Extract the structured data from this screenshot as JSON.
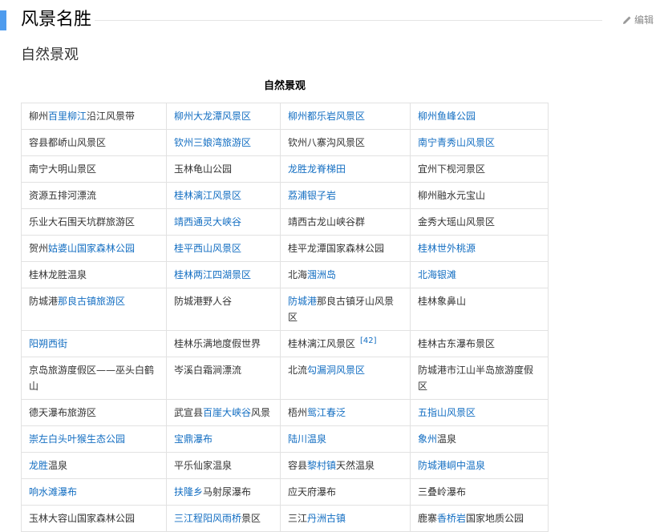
{
  "title": "风景名胜",
  "edit_label": "编辑",
  "subheading": "自然景观",
  "table_caption": "自然景观",
  "accent_color": "#4f9cee",
  "link_color": "#136ec2",
  "edit_icon": "pencil-icon",
  "rows": [
    [
      [
        {
          "t": "柳州"
        },
        {
          "t": "百里柳江",
          "l": true
        },
        {
          "t": "沿江风景带"
        }
      ],
      [
        {
          "t": "柳州大龙潭风景区",
          "l": true
        }
      ],
      [
        {
          "t": "柳州都乐岩风景区",
          "l": true
        }
      ],
      [
        {
          "t": "柳州鱼峰公园",
          "l": true
        }
      ]
    ],
    [
      [
        {
          "t": "容县都峤山风景区"
        }
      ],
      [
        {
          "t": "钦州三娘湾旅游区",
          "l": true
        }
      ],
      [
        {
          "t": "钦州八寨沟风景区"
        }
      ],
      [
        {
          "t": "南宁青秀山风景区",
          "l": true
        }
      ]
    ],
    [
      [
        {
          "t": "南宁大明山景区"
        }
      ],
      [
        {
          "t": "玉林龟山公园"
        }
      ],
      [
        {
          "t": "龙胜龙脊梯田",
          "l": true
        }
      ],
      [
        {
          "t": "宜州下枧河景区"
        }
      ]
    ],
    [
      [
        {
          "t": "资源五排河漂流"
        }
      ],
      [
        {
          "t": "桂林漓江风景区",
          "l": true
        }
      ],
      [
        {
          "t": "荔浦银子岩",
          "l": true
        }
      ],
      [
        {
          "t": "柳州融水元宝山"
        }
      ]
    ],
    [
      [
        {
          "t": "乐业大石围天坑群旅游区"
        }
      ],
      [
        {
          "t": "靖西通灵大峡谷",
          "l": true
        }
      ],
      [
        {
          "t": "靖西古龙山峡谷群"
        }
      ],
      [
        {
          "t": "金秀大瑶山风景区"
        }
      ]
    ],
    [
      [
        {
          "t": "贺州"
        },
        {
          "t": "姑婆山国家森林公园",
          "l": true
        }
      ],
      [
        {
          "t": "桂平西山风景区",
          "l": true
        }
      ],
      [
        {
          "t": "桂平龙潭国家森林公园"
        }
      ],
      [
        {
          "t": "桂林世外桃源",
          "l": true
        }
      ]
    ],
    [
      [
        {
          "t": "桂林龙胜温泉"
        }
      ],
      [
        {
          "t": "桂林两江四湖景区",
          "l": true
        }
      ],
      [
        {
          "t": "北海"
        },
        {
          "t": "涠洲岛",
          "l": true
        }
      ],
      [
        {
          "t": "北海银滩",
          "l": true
        }
      ]
    ],
    [
      [
        {
          "t": "防城港"
        },
        {
          "t": "那良古镇旅游区",
          "l": true
        }
      ],
      [
        {
          "t": "防城港野人谷"
        }
      ],
      [
        {
          "t": "防城港",
          "l": true
        },
        {
          "t": "那良古镇牙山风景区"
        }
      ],
      [
        {
          "t": "桂林象鼻山"
        }
      ]
    ],
    [
      [
        {
          "t": "阳朔西街",
          "l": true
        }
      ],
      [
        {
          "t": "桂林乐满地度假世界"
        }
      ],
      [
        {
          "t": "桂林漓江风景区"
        },
        {
          "t": "[42]",
          "s": true
        }
      ],
      [
        {
          "t": "桂林古东瀑布景区"
        }
      ]
    ],
    [
      [
        {
          "t": "京岛旅游度假区——巫头白鹤山"
        }
      ],
      [
        {
          "t": "岑溪白霜涧漂流"
        }
      ],
      [
        {
          "t": "北流"
        },
        {
          "t": "勾漏洞风景区",
          "l": true
        }
      ],
      [
        {
          "t": "防城港市江山半岛旅游度假区"
        }
      ]
    ],
    [
      [
        {
          "t": "德天瀑布旅游区"
        }
      ],
      [
        {
          "t": "武宣县"
        },
        {
          "t": "百崖大峡谷",
          "l": true
        },
        {
          "t": "风景"
        }
      ],
      [
        {
          "t": "梧州"
        },
        {
          "t": "鸳江春泛",
          "l": true
        }
      ],
      [
        {
          "t": "五指山风景区",
          "l": true
        }
      ]
    ],
    [
      [
        {
          "t": "崇左白头叶猴生态公园",
          "l": true
        }
      ],
      [
        {
          "t": "宝鼎瀑布",
          "l": true
        }
      ],
      [
        {
          "t": "陆川温泉",
          "l": true
        }
      ],
      [
        {
          "t": "象州",
          "l": true
        },
        {
          "t": "温泉"
        }
      ]
    ],
    [
      [
        {
          "t": "龙胜",
          "l": true
        },
        {
          "t": "温泉"
        }
      ],
      [
        {
          "t": "平乐仙家温泉"
        }
      ],
      [
        {
          "t": "容县"
        },
        {
          "t": "黎村镇",
          "l": true
        },
        {
          "t": "天然温泉"
        }
      ],
      [
        {
          "t": "防城港峒中温泉",
          "l": true
        }
      ]
    ],
    [
      [
        {
          "t": "响水滩瀑布",
          "l": true
        }
      ],
      [
        {
          "t": "扶隆乡",
          "l": true
        },
        {
          "t": "马射尿瀑布"
        }
      ],
      [
        {
          "t": "应天府瀑布"
        }
      ],
      [
        {
          "t": "三叠岭瀑布"
        }
      ]
    ],
    [
      [
        {
          "t": "玉林大容山国家森林公园"
        }
      ],
      [
        {
          "t": "三江程阳风雨桥",
          "l": true
        },
        {
          "t": "景区"
        }
      ],
      [
        {
          "t": "三江"
        },
        {
          "t": "丹洲古镇",
          "l": true
        }
      ],
      [
        {
          "t": "鹿寨"
        },
        {
          "t": "香桥岩",
          "l": true
        },
        {
          "t": "国家地质公园"
        }
      ]
    ]
  ]
}
